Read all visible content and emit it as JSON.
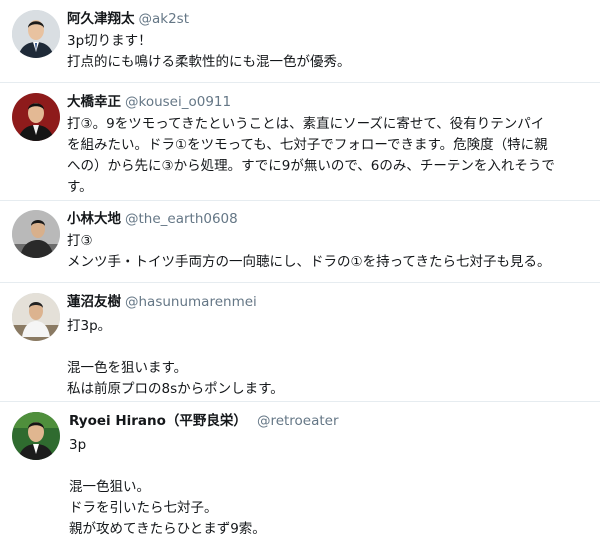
{
  "tweets": [
    {
      "avatar": "avatar-suit-man",
      "name": "阿久津翔太",
      "handle": "@ak2st",
      "lines": [
        "3p切ります！",
        "打点的にも鳴ける柔軟性的にも混一色が優秀。"
      ]
    },
    {
      "avatar": "avatar-suit-man-red-bg",
      "name": "大橋幸正",
      "handle": "@kousei_o0911",
      "lines": [
        "打③。9をツモってきたということは、素直にソーズに寄せて、役有りテンパイ",
        "を組みたい。ドラ①をツモっても、七対子でフォローできます。危険度（特に親",
        "への）から先に③から処理。すでに9が無いので、6のみ、チーテンを入れそうで",
        "す。"
      ]
    },
    {
      "avatar": "avatar-man-desk",
      "name": "小林大地",
      "handle": "@the_earth0608",
      "lines": [
        "打③",
        "メンツ手・トイツ手両方の一向聴にし、ドラの①を持ってきたら七対子も見る。"
      ]
    },
    {
      "avatar": "avatar-man-table",
      "name": "蓮沼友樹",
      "handle": "@hasunumarenmei",
      "lines": [
        "打3p。",
        "",
        "混一色を狙います。",
        "私は前原プロの8sからポンします。"
      ]
    },
    {
      "avatar": "avatar-man-green-bg",
      "name": "Ryoei Hirano（平野良栄）",
      "handle": "@retroeater",
      "lines": [
        "3p",
        "",
        "混一色狙い。",
        "ドラを引いたら七対子。",
        "親が攻めてきたらひとまず9索。"
      ]
    }
  ]
}
